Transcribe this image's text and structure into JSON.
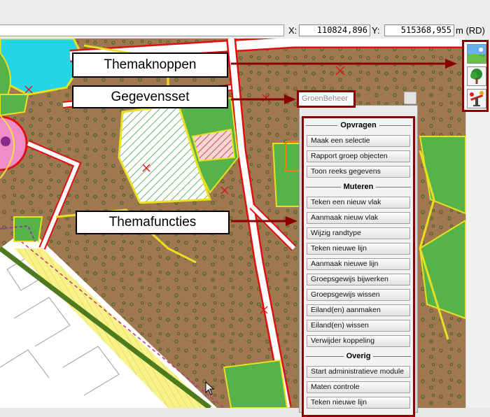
{
  "coords": {
    "x_label": "X:",
    "x_value": "110824,896",
    "y_label": "Y:",
    "y_value": "515368,955",
    "unit": "m (RD)"
  },
  "callouts": {
    "themaknoppen": "Themaknoppen",
    "gegevensset": "Gegevensset",
    "themafuncties": "Themafuncties"
  },
  "dataset": {
    "label": "GroenBeheer"
  },
  "theme_buttons": [
    {
      "icon": "landscape-icon",
      "label": ""
    },
    {
      "icon": "tree-icon",
      "label": ""
    },
    {
      "icon": "playground-icon",
      "label": ""
    }
  ],
  "panel": {
    "sections": [
      {
        "title": "Opvragen",
        "buttons": [
          "Maak een selectie",
          "Rapport groep objecten",
          "Toon reeks gegevens"
        ]
      },
      {
        "title": "Muteren",
        "buttons": [
          "Teken een nieuw vlak",
          "Aanmaak nieuw vlak",
          "Wijzig randtype",
          "Teken nieuwe lijn",
          "Aanmaak nieuwe lijn",
          "Groepsgewijs bijwerken",
          "Groepsgewijs wissen",
          "Eiland(en) aanmaken",
          "Eiland(en) wissen",
          "Verwijder koppeling"
        ]
      },
      {
        "title": "Overig",
        "buttons": [
          "Start administratieve module",
          "Maten controle",
          "Teken nieuwe lijn"
        ]
      }
    ]
  },
  "colors": {
    "arrow": "#8b0000",
    "earth": "#a0784f",
    "grass": "#55b34a",
    "water": "#22d6e6",
    "road_border": "#e01010"
  }
}
